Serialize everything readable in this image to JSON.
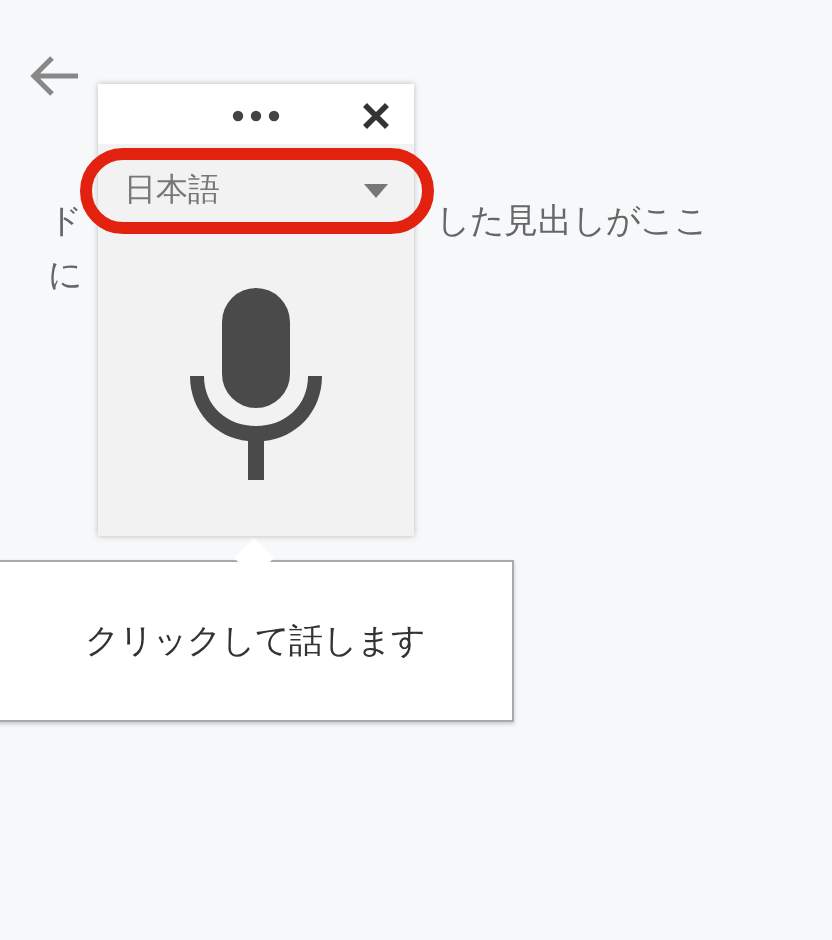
{
  "background_text": [
    {
      "text": "ド"
    },
    {
      "text": "した見出しがここ"
    },
    {
      "text": "に"
    }
  ],
  "voice_popup": {
    "language": {
      "value": "日本語",
      "highlighted": true
    }
  },
  "tooltip": {
    "text": "クリックして話します"
  }
}
